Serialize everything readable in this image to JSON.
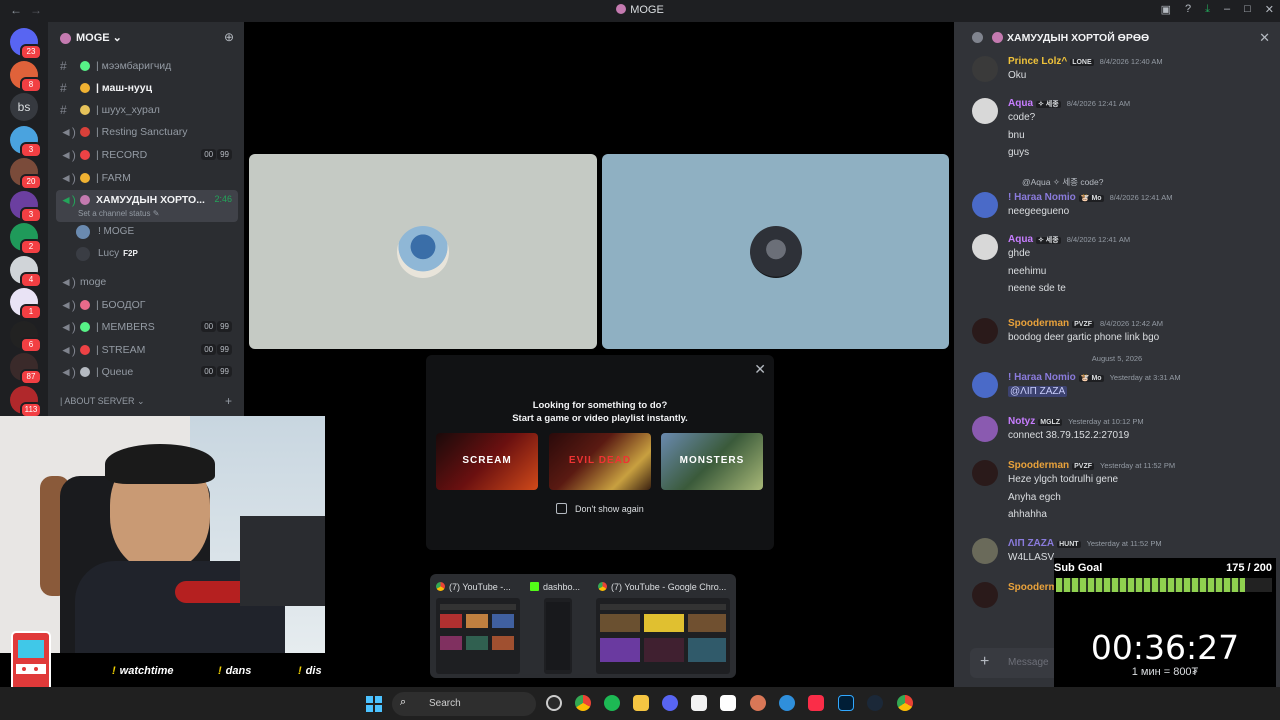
{
  "window": {
    "title": "MOGE"
  },
  "server": {
    "name": "MOGE ⌄"
  },
  "rail": [
    {
      "badge": "23",
      "color": "#5865f2"
    },
    {
      "badge": "8",
      "color": "#e0623a"
    },
    {
      "text": "bs",
      "badge": "",
      "color": "#36393f"
    },
    {
      "badge": "3",
      "color": "#4aa3df"
    },
    {
      "badge": "20",
      "color": "#7a4b3a"
    },
    {
      "badge": "3",
      "color": "#6b3fa0"
    },
    {
      "badge": "2",
      "color": "#1f9a5a"
    },
    {
      "badge": "4",
      "color": "#d0d4d8"
    },
    {
      "badge": "1",
      "color": "#e9e3f5"
    },
    {
      "badge": "6",
      "color": "#222222"
    },
    {
      "badge": "87",
      "color": "#3a2a2a"
    },
    {
      "badge": "113",
      "color": "#b0282b"
    }
  ],
  "channels": [
    {
      "name": "| мээмбаригчид",
      "emoji_color": "#57f287",
      "type": "text"
    },
    {
      "name": "| маш-нууц",
      "emoji_color": "#f0b232",
      "type": "text",
      "bold": true
    },
    {
      "name": "| шуух_хурал",
      "emoji_color": "#e6c25a",
      "type": "text"
    },
    {
      "name": "| Resting Sanctuary",
      "emoji_color": "#d8403a",
      "type": "voice"
    },
    {
      "name": "| RECORD",
      "emoji_color": "#ed4245",
      "type": "voice",
      "counts": [
        "00",
        "99"
      ]
    },
    {
      "name": "| FARM",
      "emoji_color": "#f0b232",
      "type": "voice"
    },
    {
      "name": "ХАМУУДЫН ХОРТО...",
      "emoji_color": "#c47ab0",
      "type": "voice",
      "active": true,
      "timer": "2:46",
      "status": "Set a channel status ✎"
    },
    {
      "name": "moge",
      "type": "voice"
    },
    {
      "name": "| БООДОГ",
      "emoji_color": "#e86a8a",
      "type": "voice"
    },
    {
      "name": "| MEMBERS",
      "emoji_color": "#57f287",
      "type": "voice",
      "counts": [
        "00",
        "99"
      ]
    },
    {
      "name": "| STREAM",
      "emoji_color": "#ed4245",
      "type": "voice",
      "counts": [
        "00",
        "99"
      ]
    },
    {
      "name": "| Queue",
      "emoji_color": "#b5bac1",
      "type": "voice",
      "counts": [
        "00",
        "99"
      ]
    }
  ],
  "voice_users": [
    {
      "name": "! MOGE",
      "tag": ""
    },
    {
      "name": "Lucy",
      "tag": "F2P"
    }
  ],
  "category": "| ABOUT SERVER ⌄",
  "activity": {
    "line1": "Looking for something to do?",
    "line2": "Start a game or video playlist instantly.",
    "cards": [
      "SCREAM",
      "EVIL DEAD",
      "MONSTERS"
    ],
    "checkbox": "Don't show again"
  },
  "tabs": [
    {
      "title": "(7) YouTube -..."
    },
    {
      "title": "dashbo..."
    },
    {
      "title": "(7) YouTube - Google Chro..."
    }
  ],
  "chat": {
    "title": "ХАМУУДЫН ХОРТОЙ ӨРӨӨ",
    "placeholder": "Message",
    "date_separator": "August 5, 2026",
    "messages": [
      {
        "author": "Prince Lolz^",
        "color": "#f0c33a",
        "tag": "LONE",
        "time": "8/4/2026 12:40 AM",
        "lines": [
          "Oku"
        ]
      },
      {
        "author": "Aqua",
        "color": "#c77dff",
        "tag": "✧ 세종",
        "time": "8/4/2026 12:41 AM",
        "lines": [
          "code?",
          "bnu",
          "guys"
        ]
      },
      {
        "reply": "@Aqua ✧ 세종 code?",
        "author": "! Haraa Nomio",
        "color": "#8a7bdc",
        "tag": "🐮 Mo",
        "time": "8/4/2026 12:41 AM",
        "lines": [
          "neegeegueno"
        ]
      },
      {
        "author": "Aqua",
        "color": "#c77dff",
        "tag": "✧ 세종",
        "time": "8/4/2026 12:41 AM",
        "lines": [
          "ghde",
          "neehimu",
          "neene sde te"
        ]
      },
      {
        "author": "Spooderman",
        "color": "#e9a23b",
        "tag": "PVZF",
        "time": "8/4/2026 12:42 AM",
        "lines": [
          "boodog deer gartic phone link bgo"
        ]
      },
      {
        "author": "! Haraa Nomio",
        "color": "#8a7bdc",
        "tag": "🐮 Mo",
        "time": "Yesterday at 3:31 AM",
        "lines": [
          "@ΛIΠ ZAZA"
        ]
      },
      {
        "author": "Notyz",
        "color": "#c77dff",
        "tag": "MGLZ",
        "time": "Yesterday at 10:12 PM",
        "lines": [
          "connect 38.79.152.2:27019"
        ]
      },
      {
        "author": "Spooderman",
        "color": "#e9a23b",
        "tag": "PVZF",
        "time": "Yesterday at 11:52 PM",
        "lines": [
          "Heze ylgch todrulhi gene",
          "Anyha egch",
          "ahhahha"
        ]
      },
      {
        "author": "ΛIΠ ZAZA",
        "color": "#8a7bdc",
        "tag": "HUNT",
        "time": "Yesterday at 11:52 PM",
        "lines": [
          "W4LLASV"
        ]
      },
      {
        "author": "Spooderman",
        "color": "#e9a23b",
        "tag": "",
        "time": "",
        "lines": []
      }
    ]
  },
  "subgoal": {
    "label": "Sub Goal",
    "value": "175 / 200",
    "progress": 0.875,
    "timer": "00:36:27",
    "rate": "1 мин = 800₮"
  },
  "ticker": [
    "watchtime",
    "dans",
    "dis"
  ],
  "taskbar": {
    "search": "Search"
  }
}
